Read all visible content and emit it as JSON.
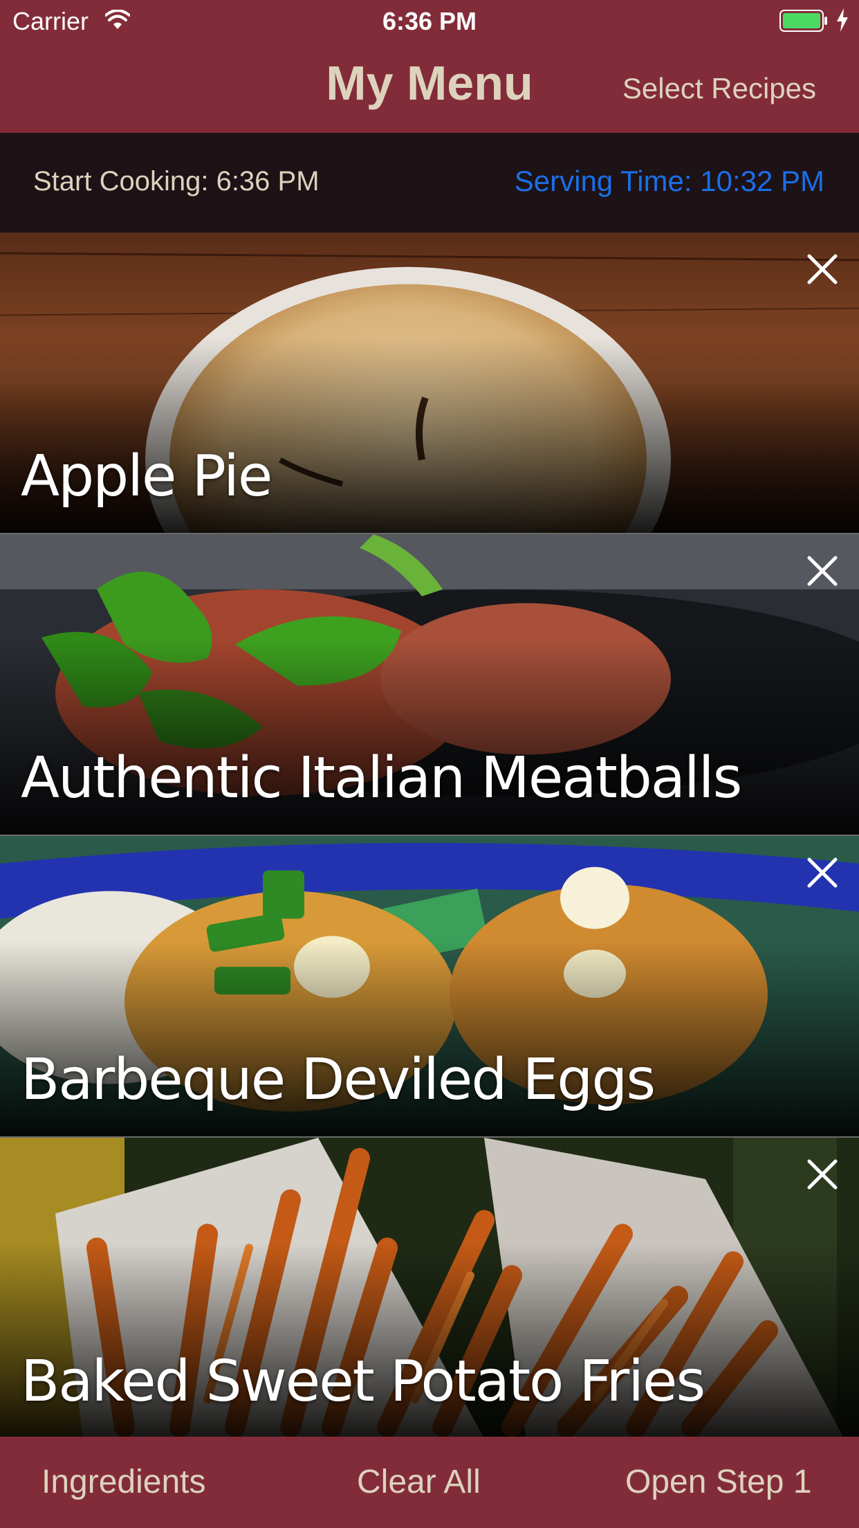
{
  "status_bar": {
    "carrier": "Carrier",
    "time": "6:36 PM",
    "battery_color": "#4cd964"
  },
  "nav": {
    "title": "My Menu",
    "select_label": "Select Recipes"
  },
  "times": {
    "start_cooking": "Start Cooking: 6:36 PM",
    "serving_time": "Serving Time: 10:32 PM"
  },
  "recipes": [
    {
      "title": "Apple Pie",
      "photo_icon": "apple-pie-photo"
    },
    {
      "title": "Authentic Italian Meatballs",
      "photo_icon": "meatballs-photo"
    },
    {
      "title": "Barbeque Deviled Eggs",
      "photo_icon": "deviled-eggs-photo"
    },
    {
      "title": "Baked Sweet Potato Fries",
      "photo_icon": "sweet-potato-fries-photo"
    }
  ],
  "toolbar": {
    "ingredients": "Ingredients",
    "clear_all": "Clear All",
    "open_step": "Open Step 1"
  },
  "colors": {
    "brand": "#832c39",
    "accent_text": "#ddd3bd",
    "link_blue": "#1a6fe6"
  }
}
